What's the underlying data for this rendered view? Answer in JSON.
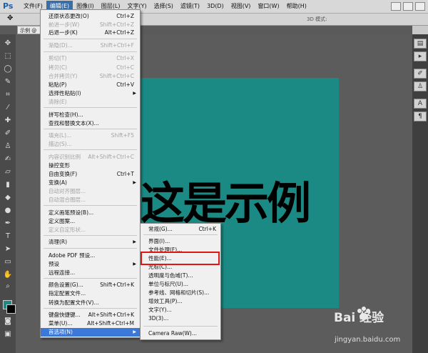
{
  "app": {
    "logo": "Ps"
  },
  "menubar": {
    "items": [
      "文件(F)",
      "编辑(E)",
      "图像(I)",
      "图层(L)",
      "文字(Y)",
      "选择(S)",
      "滤镜(T)",
      "3D(D)",
      "视图(V)",
      "窗口(W)",
      "帮助(H)"
    ],
    "active_index": 1
  },
  "options_bar": {
    "mode_label": "3D 模式:"
  },
  "doc_tab": {
    "label": "示例 @"
  },
  "canvas": {
    "text": "这是示例",
    "color": "#1b8a84"
  },
  "edit_menu": {
    "items": [
      {
        "label": "还原状态更改(O)",
        "shortcut": "Ctrl+Z",
        "disabled": false
      },
      {
        "label": "前进一步(W)",
        "shortcut": "Shift+Ctrl+Z",
        "disabled": true
      },
      {
        "label": "后退一步(K)",
        "shortcut": "Alt+Ctrl+Z",
        "disabled": false
      },
      {
        "label": "渐隐(D)...",
        "shortcut": "Shift+Ctrl+F",
        "disabled": true
      },
      {
        "label": "剪切(T)",
        "shortcut": "Ctrl+X",
        "disabled": true
      },
      {
        "label": "拷贝(C)",
        "shortcut": "Ctrl+C",
        "disabled": true
      },
      {
        "label": "合并拷贝(Y)",
        "shortcut": "Shift+Ctrl+C",
        "disabled": true
      },
      {
        "label": "粘贴(P)",
        "shortcut": "Ctrl+V",
        "disabled": false
      },
      {
        "label": "选择性粘贴(I)",
        "shortcut": "",
        "disabled": false,
        "submenu": true
      },
      {
        "label": "清除(E)",
        "shortcut": "",
        "disabled": true
      },
      {
        "label": "拼写检查(H)...",
        "shortcut": "",
        "disabled": false
      },
      {
        "label": "查找和替换文本(X)...",
        "shortcut": "",
        "disabled": false
      },
      {
        "label": "填充(L)...",
        "shortcut": "Shift+F5",
        "disabled": true
      },
      {
        "label": "描边(S)...",
        "shortcut": "",
        "disabled": true
      },
      {
        "label": "内容识别比例",
        "shortcut": "Alt+Shift+Ctrl+C",
        "disabled": true
      },
      {
        "label": "操控变形",
        "shortcut": "",
        "disabled": false
      },
      {
        "label": "自由变换(F)",
        "shortcut": "Ctrl+T",
        "disabled": false
      },
      {
        "label": "变换(A)",
        "shortcut": "",
        "disabled": false,
        "submenu": true
      },
      {
        "label": "自动对齐图层...",
        "shortcut": "",
        "disabled": true
      },
      {
        "label": "自动混合图层...",
        "shortcut": "",
        "disabled": true
      },
      {
        "label": "定义画笔预设(B)...",
        "shortcut": "",
        "disabled": false
      },
      {
        "label": "定义图案...",
        "shortcut": "",
        "disabled": false
      },
      {
        "label": "定义自定形状...",
        "shortcut": "",
        "disabled": true
      },
      {
        "label": "清理(R)",
        "shortcut": "",
        "disabled": false,
        "submenu": true
      },
      {
        "label": "Adobe PDF 预设...",
        "shortcut": "",
        "disabled": false
      },
      {
        "label": "预设",
        "shortcut": "",
        "disabled": false,
        "submenu": true
      },
      {
        "label": "远程连接...",
        "shortcut": "",
        "disabled": false
      },
      {
        "label": "颜色设置(G)...",
        "shortcut": "Shift+Ctrl+K",
        "disabled": false
      },
      {
        "label": "指定配置文件...",
        "shortcut": "",
        "disabled": false
      },
      {
        "label": "转换为配置文件(V)...",
        "shortcut": "",
        "disabled": false
      },
      {
        "label": "键盘快捷键...",
        "shortcut": "Alt+Shift+Ctrl+K",
        "disabled": false
      },
      {
        "label": "菜单(U)...",
        "shortcut": "Alt+Shift+Ctrl+M",
        "disabled": false
      },
      {
        "label": "首选项(N)",
        "shortcut": "",
        "disabled": false,
        "submenu": true,
        "selected": true
      }
    ]
  },
  "preferences_menu": {
    "items": [
      {
        "label": "常规(G)...",
        "shortcut": "Ctrl+K"
      },
      {
        "label": "界面(I)...",
        "shortcut": ""
      },
      {
        "label": "文件处理(F)...",
        "shortcut": ""
      },
      {
        "label": "性能(E)...",
        "shortcut": "",
        "highlighted": true
      },
      {
        "label": "光标(C)...",
        "shortcut": ""
      },
      {
        "label": "透明度与色域(T)...",
        "shortcut": ""
      },
      {
        "label": "单位与标尺(U)...",
        "shortcut": ""
      },
      {
        "label": "参考线、网格和切片(S)...",
        "shortcut": ""
      },
      {
        "label": "增效工具(P)...",
        "shortcut": ""
      },
      {
        "label": "文字(Y)...",
        "shortcut": ""
      },
      {
        "label": "3D(3)...",
        "shortcut": ""
      },
      {
        "label": "Camera Raw(W)...",
        "shortcut": ""
      }
    ]
  },
  "watermark": {
    "text": "Bai 经验",
    "url": "jingyan.baidu.com"
  }
}
